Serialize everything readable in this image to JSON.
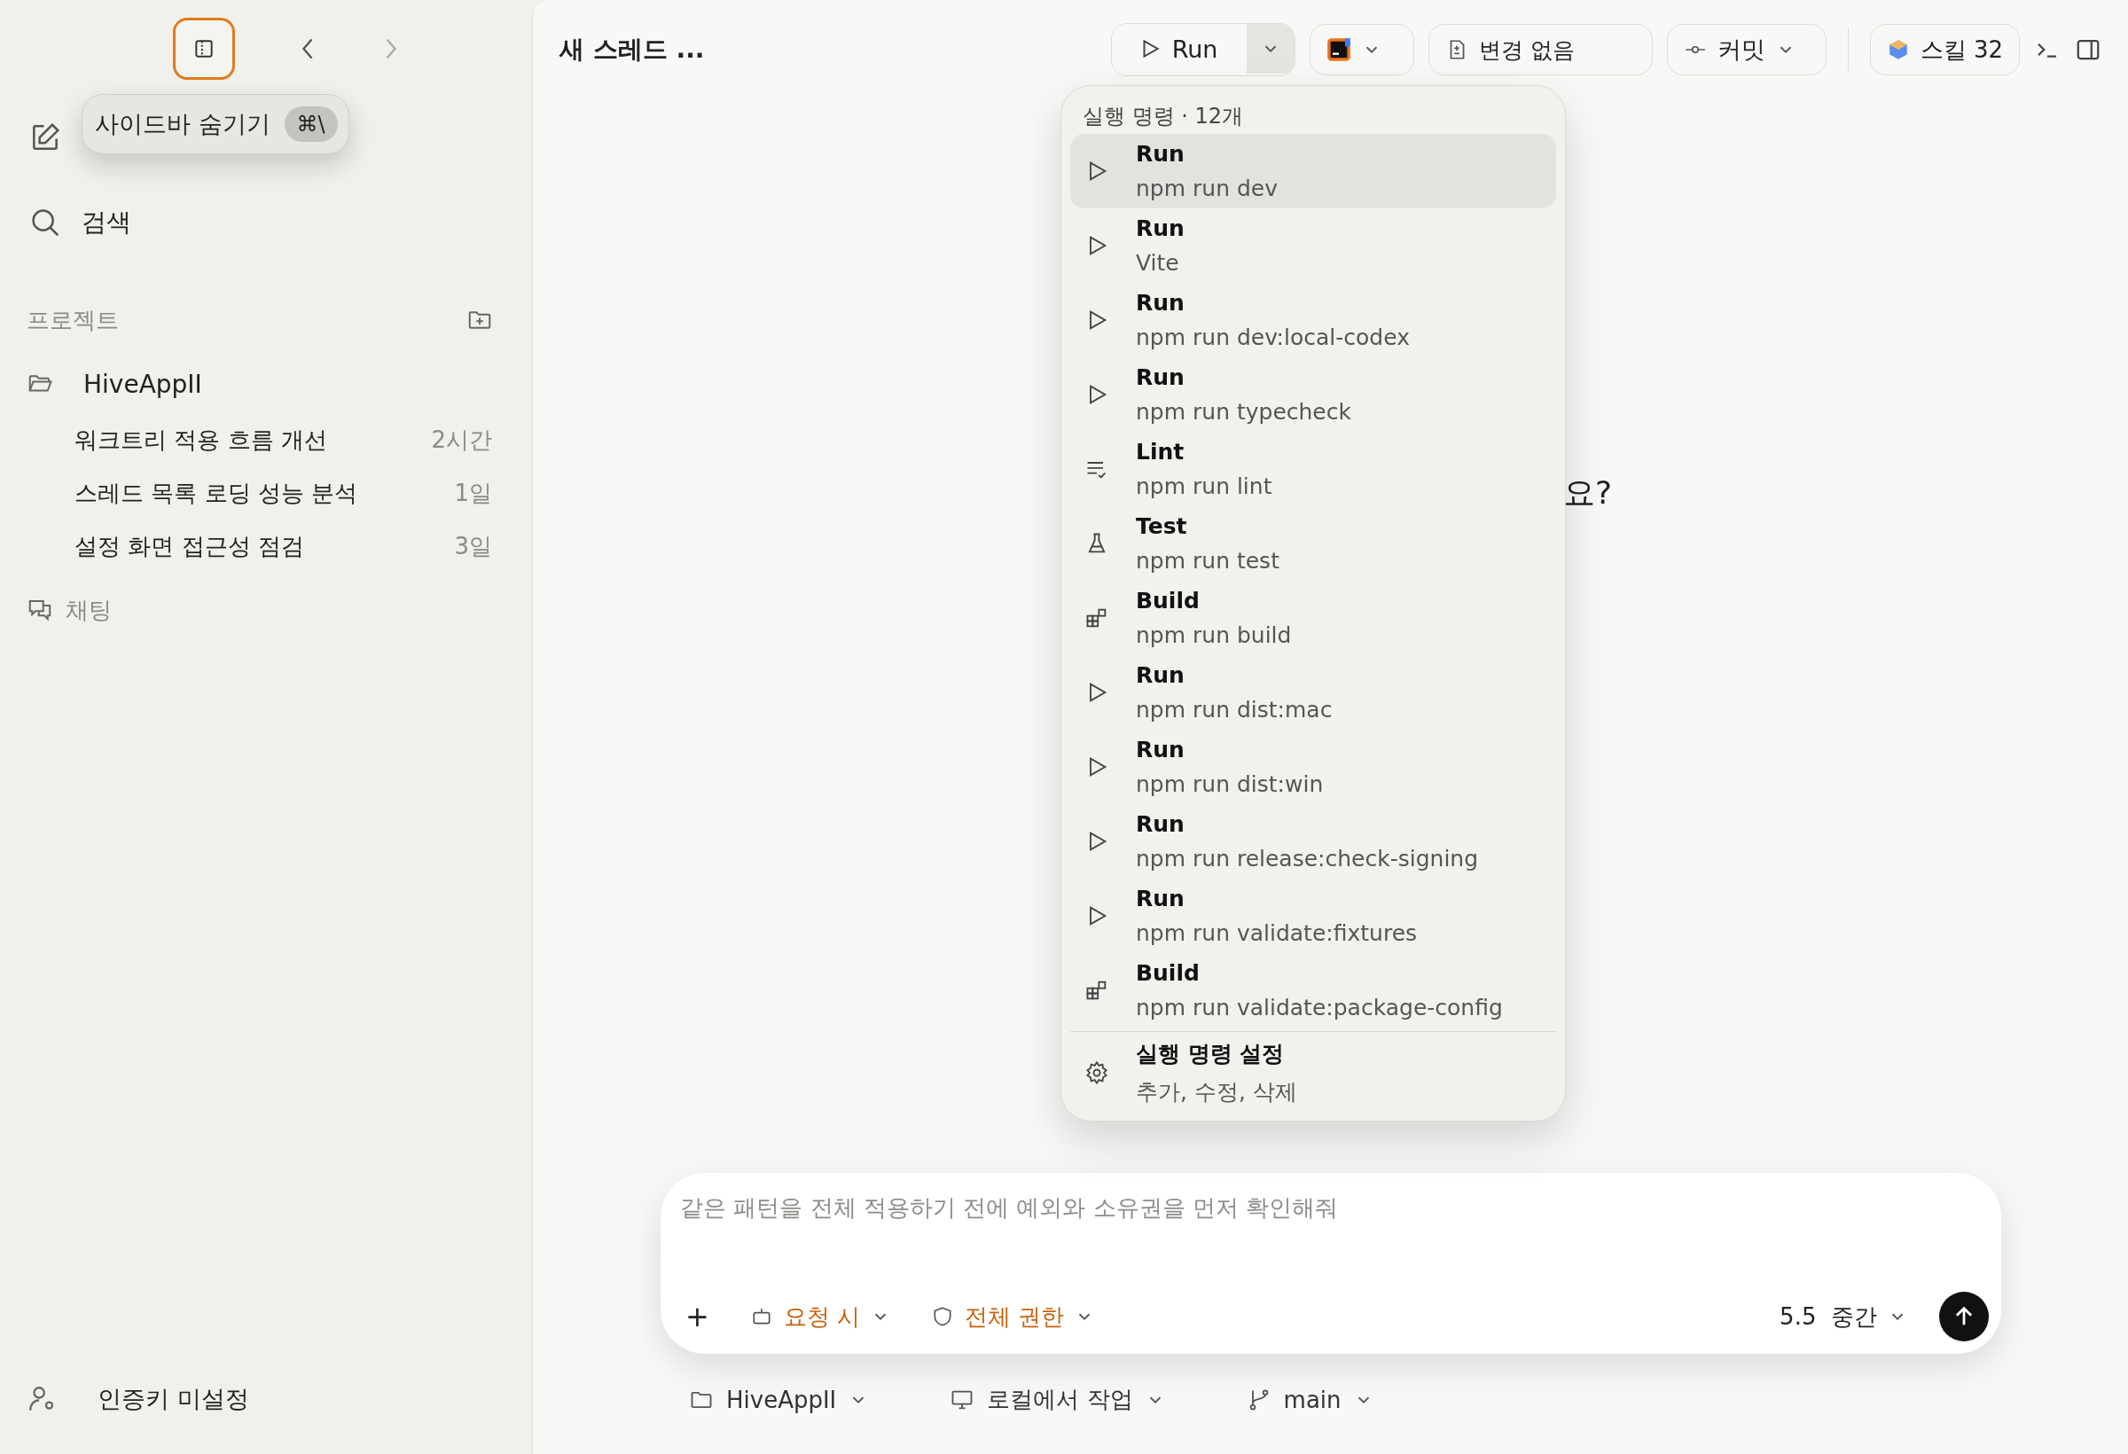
{
  "sidebar": {
    "tooltip": {
      "label": "사이드바 숨기기",
      "shortcut": "⌘\\"
    },
    "search_label": "검색",
    "projects_title": "프로젝트",
    "projects": [
      {
        "name": "HiveAppII",
        "threads": [
          {
            "title": "워크트리 적용 흐름 개선",
            "time": "2시간"
          },
          {
            "title": "스레드 목록 로딩 성능 분석",
            "time": "1일"
          },
          {
            "title": "설정 화면 접근성 점검",
            "time": "3일"
          }
        ]
      }
    ],
    "chat_label": "채팅",
    "auth_label": "인증키 미설정"
  },
  "header": {
    "title": "새 스레드 ..."
  },
  "toolbar": {
    "run_label": "Run",
    "run_menu_open": true,
    "changes_label": "변경 없음",
    "commit_label": "커밋",
    "skills_label": "스킬 32"
  },
  "heading_visible_part": "요?",
  "run_menu": {
    "title": "실행 명령 · 12개",
    "items": [
      {
        "kind": "run",
        "label": "Run",
        "command": "npm run dev",
        "selected": true
      },
      {
        "kind": "run",
        "label": "Run",
        "command": "Vite",
        "selected": false
      },
      {
        "kind": "run",
        "label": "Run",
        "command": "npm run dev:local-codex",
        "selected": false
      },
      {
        "kind": "run",
        "label": "Run",
        "command": "npm run typecheck",
        "selected": false
      },
      {
        "kind": "lint",
        "label": "Lint",
        "command": "npm run lint",
        "selected": false
      },
      {
        "kind": "test",
        "label": "Test",
        "command": "npm run test",
        "selected": false
      },
      {
        "kind": "build",
        "label": "Build",
        "command": "npm run build",
        "selected": false
      },
      {
        "kind": "run",
        "label": "Run",
        "command": "npm run dist:mac",
        "selected": false
      },
      {
        "kind": "run",
        "label": "Run",
        "command": "npm run dist:win",
        "selected": false
      },
      {
        "kind": "run",
        "label": "Run",
        "command": "npm run release:check-signing",
        "selected": false
      },
      {
        "kind": "run",
        "label": "Run",
        "command": "npm run validate:fixtures",
        "selected": false
      },
      {
        "kind": "build",
        "label": "Build",
        "command": "npm run validate:package-config",
        "selected": false
      }
    ],
    "settings": {
      "label": "실행 명령 설정",
      "description": "추가, 수정, 삭제"
    }
  },
  "composer": {
    "placeholder": "같은 패턴을 전체 적용하기 전에 예외와 소유권을 먼저 확인해줘",
    "add": "+",
    "approval": "요청 시",
    "permission": "전체 권한",
    "model": "5.5",
    "effort": "중간"
  },
  "footer": {
    "project": "HiveAppII",
    "environment": "로컬에서 작업",
    "branch": "main"
  }
}
